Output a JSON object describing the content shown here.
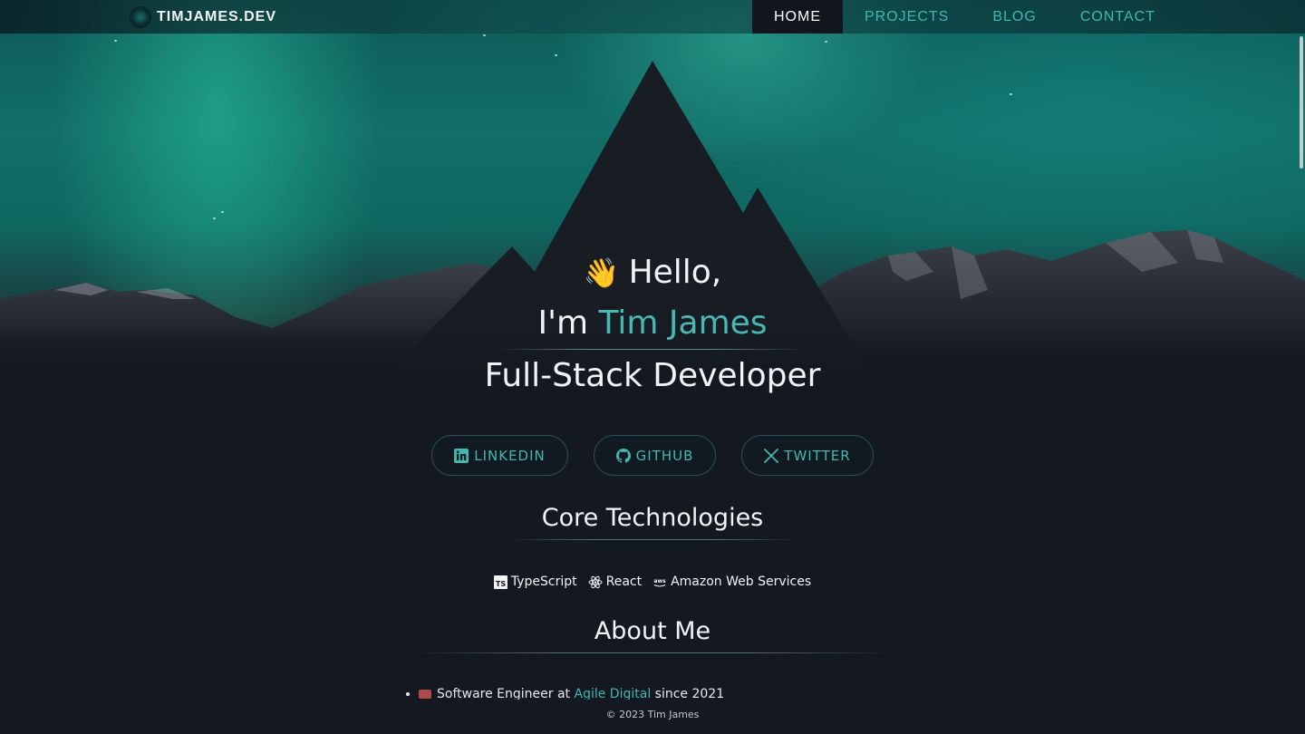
{
  "brand": {
    "name": "TIMJAMES.DEV",
    "logo_icon": "logo-icon"
  },
  "nav": {
    "items": [
      {
        "label": "HOME",
        "active": true
      },
      {
        "label": "PROJECTS",
        "active": false
      },
      {
        "label": "BLOG",
        "active": false
      },
      {
        "label": "CONTACT",
        "active": false
      }
    ]
  },
  "hero": {
    "wave": "👋",
    "hello": "Hello,",
    "im": "I'm",
    "name": "Tim James",
    "role": "Full-Stack Developer"
  },
  "social": {
    "linkedin": "LINKEDIN",
    "github": "GITHUB",
    "twitter": "TWITTER"
  },
  "core": {
    "title": "Core Technologies",
    "items": [
      "TypeScript",
      "React",
      "Amazon Web Services"
    ]
  },
  "about": {
    "title": "About Me",
    "line_prefix": "Software Engineer at",
    "company": "Agile Digital",
    "line_suffix": "since 2021"
  },
  "footer": {
    "text": "© 2023 Tim James"
  },
  "colors": {
    "accent": "#43b6b2",
    "background": "#141820",
    "nav_active_bg": "#11161c"
  }
}
